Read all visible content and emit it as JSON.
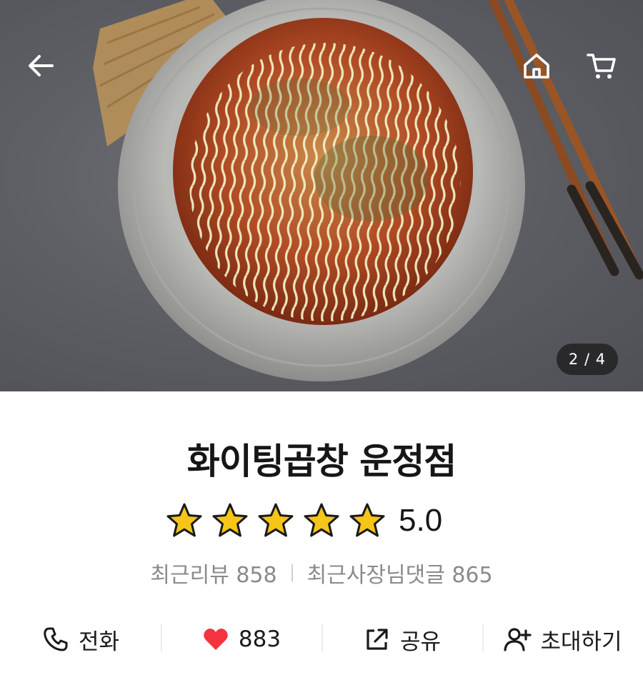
{
  "header": {
    "back_icon": "arrow-left-icon",
    "home_icon": "home-icon",
    "cart_icon": "cart-icon",
    "image_counter": "2 / 4"
  },
  "store": {
    "name": "화이팅곱창 운정점",
    "rating": "5.0",
    "stars": 5,
    "recent_reviews_label": "최근리뷰 858",
    "recent_owner_replies_label": "최근사장님댓글 865"
  },
  "actions": [
    {
      "icon": "phone-icon",
      "label": "전화"
    },
    {
      "icon": "heart-icon",
      "label": "883"
    },
    {
      "icon": "share-icon",
      "label": "공유"
    },
    {
      "icon": "invite-user-icon",
      "label": "초대하기"
    }
  ],
  "colors": {
    "star": "#f5c518",
    "heart": "#f5333f",
    "text": "#161616",
    "muted": "#8a8a8a"
  }
}
